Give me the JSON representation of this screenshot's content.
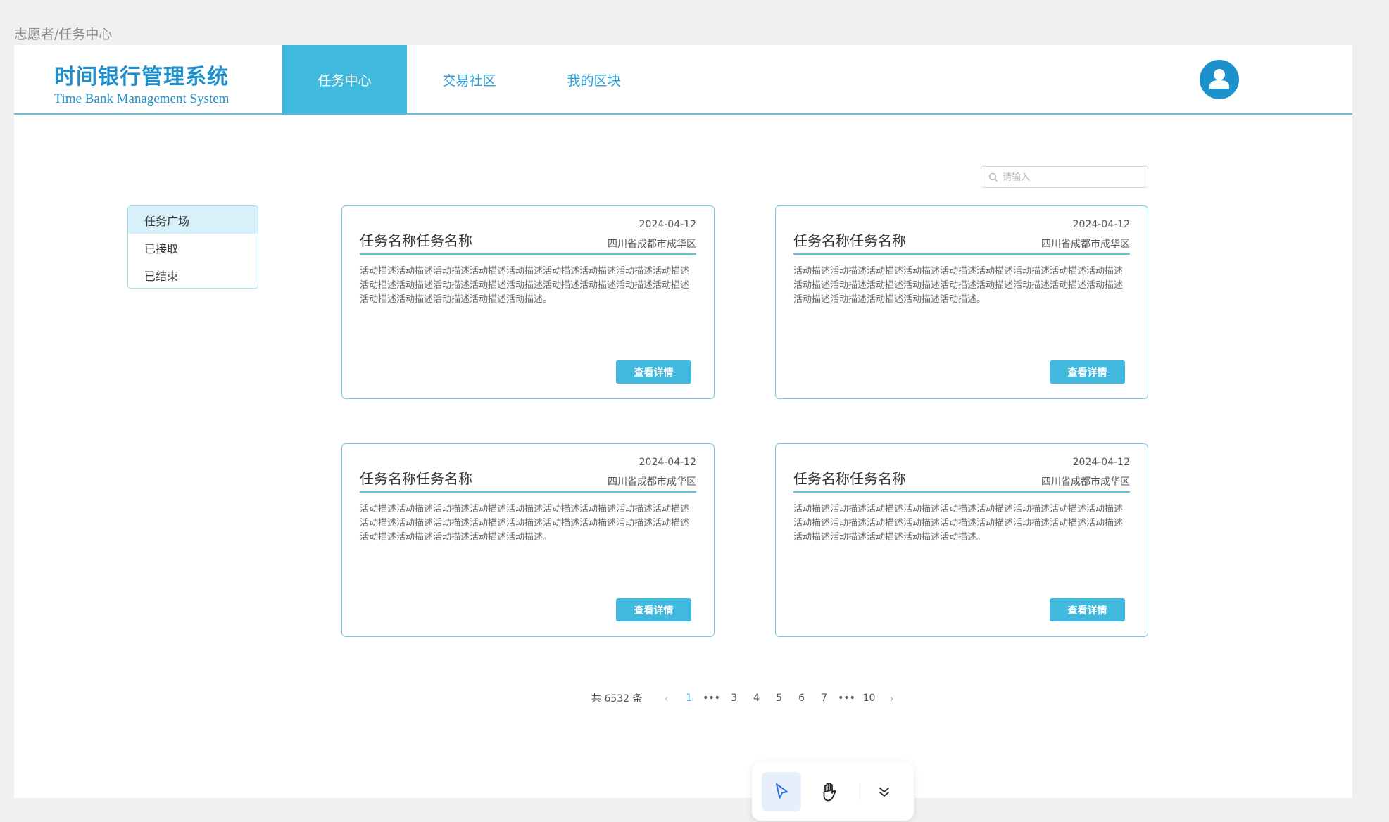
{
  "breadcrumb": "志愿者/任务中心",
  "logo": {
    "cn": "时间银行管理系统",
    "en": "Time Bank Management System"
  },
  "nav": {
    "items": [
      {
        "label": "任务中心",
        "active": true
      },
      {
        "label": "交易社区",
        "active": false
      },
      {
        "label": "我的区块",
        "active": false
      }
    ]
  },
  "user": {
    "icon": "user-icon"
  },
  "search": {
    "placeholder": "请输入",
    "value": "",
    "icon": "search-icon"
  },
  "side_menu": {
    "items": [
      {
        "label": "任务广场",
        "active": true
      },
      {
        "label": "已接取",
        "active": false
      },
      {
        "label": "已结束",
        "active": false
      }
    ]
  },
  "cards": [
    {
      "title": "任务名称任务名称",
      "date": "2024-04-12",
      "location": "四川省成都市成华区",
      "description": "活动描述活动描述活动描述活动描述活动描述活动描述活动描述活动描述活动描述活动描述活动描述活动描述活动描述活动描述活动描述活动描述活动描述活动描述活动描述活动描述活动描述活动描述活动描述。",
      "button": "查看详情"
    },
    {
      "title": "任务名称任务名称",
      "date": "2024-04-12",
      "location": "四川省成都市成华区",
      "description": "活动描述活动描述活动描述活动描述活动描述活动描述活动描述活动描述活动描述活动描述活动描述活动描述活动描述活动描述活动描述活动描述活动描述活动描述活动描述活动描述活动描述活动描述活动描述。",
      "button": "查看详情"
    },
    {
      "title": "任务名称任务名称",
      "date": "2024-04-12",
      "location": "四川省成都市成华区",
      "description": "活动描述活动描述活动描述活动描述活动描述活动描述活动描述活动描述活动描述活动描述活动描述活动描述活动描述活动描述活动描述活动描述活动描述活动描述活动描述活动描述活动描述活动描述活动描述。",
      "button": "查看详情"
    },
    {
      "title": "任务名称任务名称",
      "date": "2024-04-12",
      "location": "四川省成都市成华区",
      "description": "活动描述活动描述活动描述活动描述活动描述活动描述活动描述活动描述活动描述活动描述活动描述活动描述活动描述活动描述活动描述活动描述活动描述活动描述活动描述活动描述活动描述活动描述活动描述。",
      "button": "查看详情"
    }
  ],
  "pagination": {
    "total_label": "共 6532 条",
    "prev": "‹",
    "next": "›",
    "pages": [
      "1",
      "•••",
      "3",
      "4",
      "5",
      "6",
      "7",
      "•••",
      "10"
    ],
    "current": "1"
  },
  "toolbar": {
    "items": [
      {
        "icon": "pointer-icon",
        "active": true
      },
      {
        "icon": "hand-icon",
        "active": false
      },
      {
        "icon": "double-chevron-down-icon",
        "active": false
      }
    ]
  },
  "colors": {
    "accent": "#41b8de",
    "brand": "#1f8fc9",
    "border": "#74c9e6"
  }
}
